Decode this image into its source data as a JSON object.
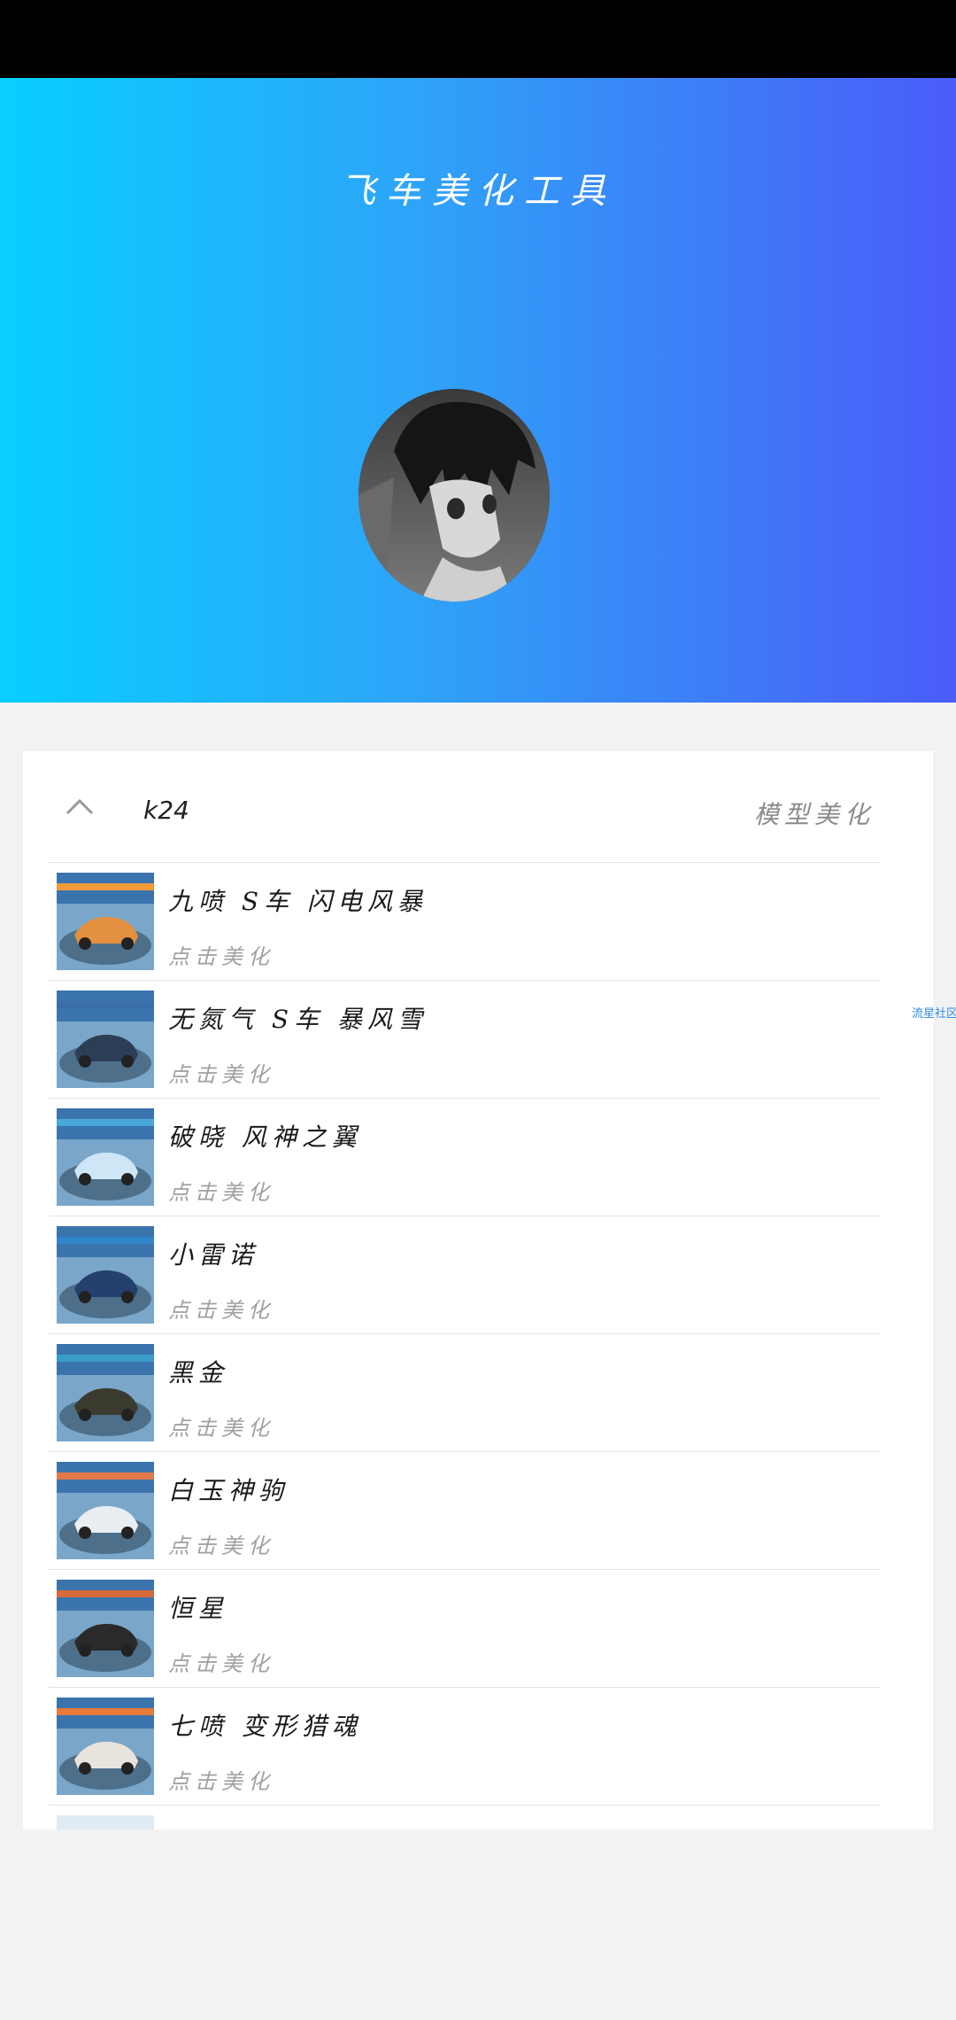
{
  "hero": {
    "title": "飞车美化工具"
  },
  "card": {
    "header_name": "k24",
    "header_right": "模型美化"
  },
  "side_link": "流星社区",
  "items": [
    {
      "title": "九喷 S车 闪电风暴",
      "action": "点击美化",
      "accent": "#f09a3a",
      "car": "#e39040"
    },
    {
      "title": "无氮气 S车 暴风雪",
      "action": "点击美化",
      "accent": "#3a6ea8",
      "car": "#2c3e55"
    },
    {
      "title": "破晓 风神之翼",
      "action": "点击美化",
      "accent": "#4aa8d8",
      "car": "#cfe6f7"
    },
    {
      "title": "小雷诺",
      "action": "点击美化",
      "accent": "#2f86c8",
      "car": "#24406d"
    },
    {
      "title": "黑金",
      "action": "点击美化",
      "accent": "#3a9cc8",
      "car": "#3a3a2e"
    },
    {
      "title": "白玉神驹",
      "action": "点击美化",
      "accent": "#e07a4a",
      "car": "#e9eef3"
    },
    {
      "title": "恒星",
      "action": "点击美化",
      "accent": "#d56a3c",
      "car": "#2a2a2a"
    },
    {
      "title": "七喷 变形猎魂",
      "action": "点击美化",
      "accent": "#e67a3a",
      "car": "#e9e3de"
    }
  ]
}
